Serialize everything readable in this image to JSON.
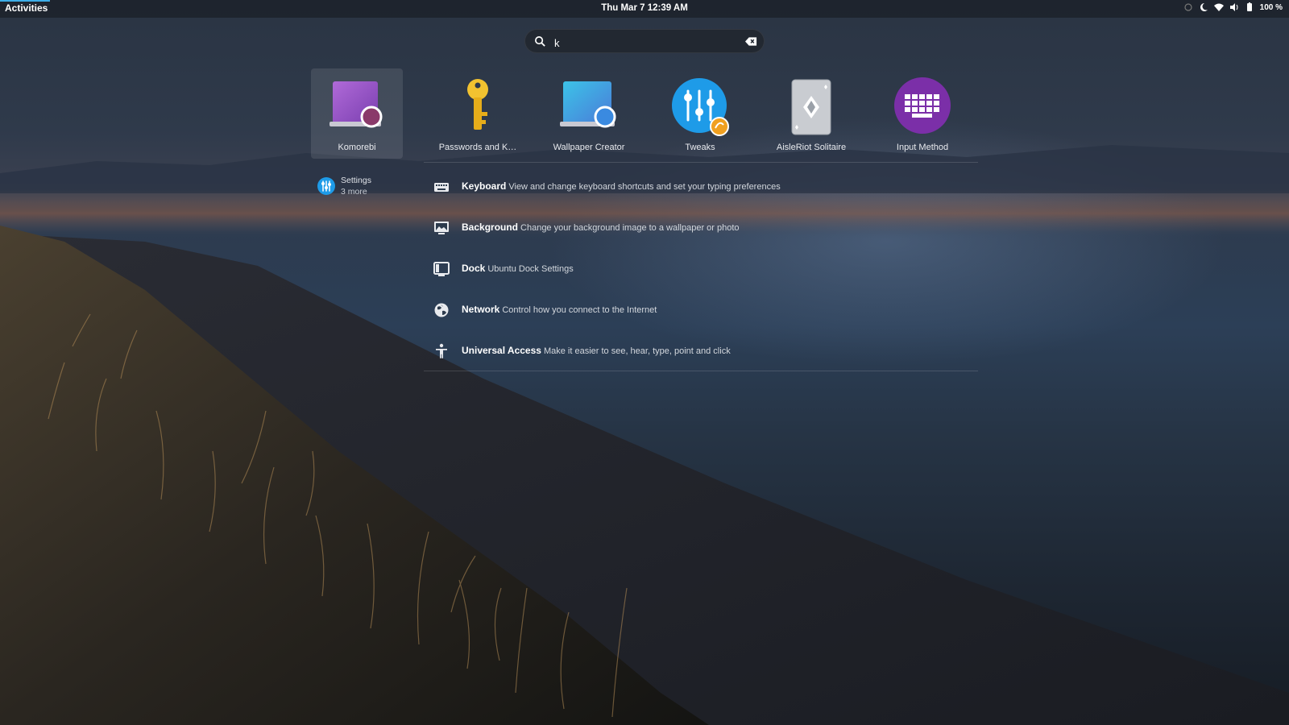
{
  "topbar": {
    "activities": "Activities",
    "clock": "Thu Mar 7  12:39 AM",
    "battery": "100 %"
  },
  "search": {
    "value": "k",
    "icon": "search-icon",
    "clear_icon": "backspace-icon"
  },
  "apps": [
    {
      "label": "Komorebi",
      "icon": "komorebi-icon",
      "selected": true
    },
    {
      "label": "Passwords and K…",
      "icon": "key-icon"
    },
    {
      "label": "Wallpaper Creator",
      "icon": "wallpaper-creator-icon"
    },
    {
      "label": "Tweaks",
      "icon": "tweaks-icon"
    },
    {
      "label": "AisleRiot Solitaire",
      "icon": "solitaire-card-icon"
    },
    {
      "label": "Input Method",
      "icon": "input-method-keyboard-icon"
    }
  ],
  "provider": {
    "name": "Settings",
    "more": "3 more",
    "icon": "settings-icon"
  },
  "results": [
    {
      "title": "Keyboard",
      "description": "View and change keyboard shortcuts and set your typing preferences",
      "icon": "keyboard-icon"
    },
    {
      "title": "Background",
      "description": "Change your background image to a wallpaper or photo",
      "icon": "background-icon"
    },
    {
      "title": "Dock",
      "description": "Ubuntu Dock Settings",
      "icon": "dock-icon"
    },
    {
      "title": "Network",
      "description": "Control how you connect to the Internet",
      "icon": "network-globe-icon"
    },
    {
      "title": "Universal Access",
      "description": "Make it easier to see, hear, type, point and click",
      "icon": "universal-access-icon"
    }
  ],
  "colors": {
    "accent": "#3daee9",
    "search_bg": "#222831"
  }
}
